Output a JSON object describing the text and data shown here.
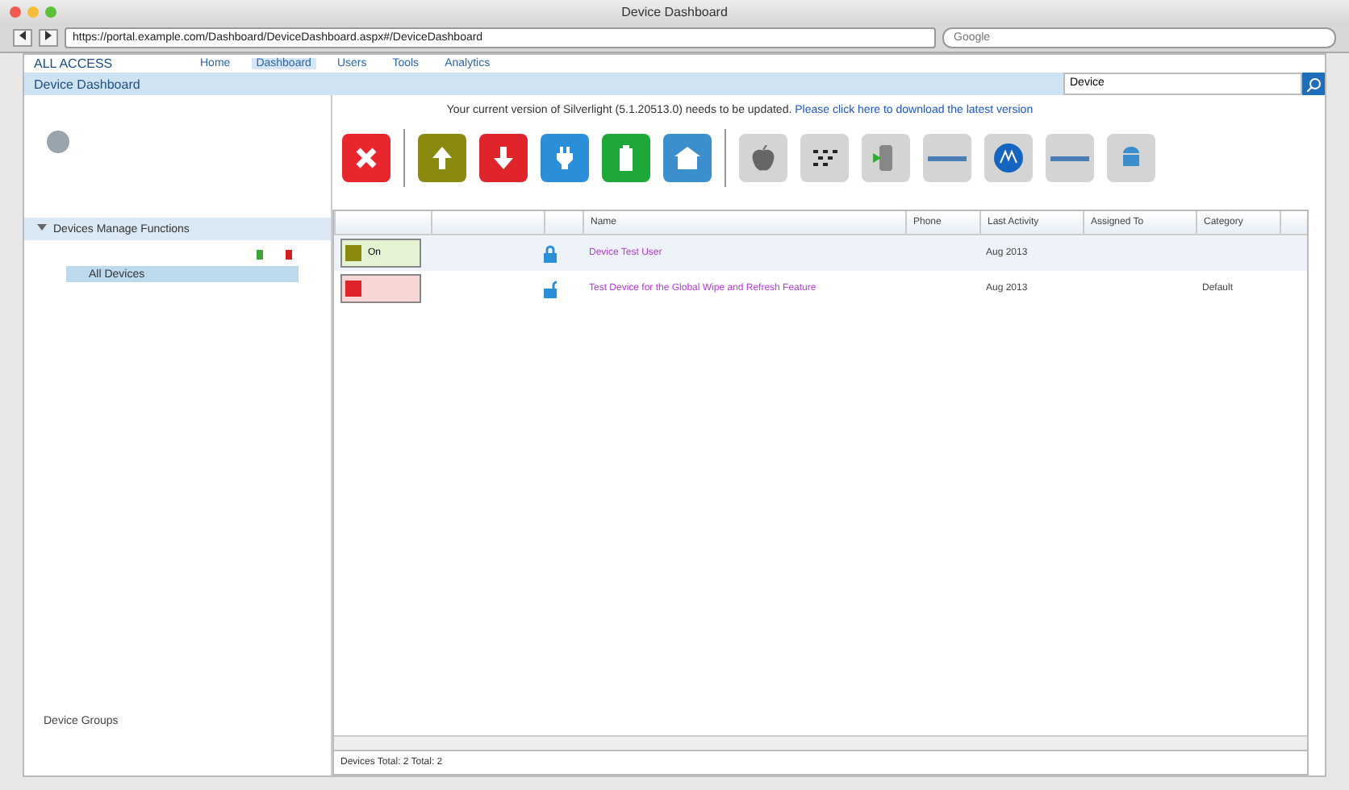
{
  "window": {
    "title": "Device Dashboard"
  },
  "browser": {
    "url": "https://portal.example.com/Dashboard/DeviceDashboard.aspx#/DeviceDashboard",
    "search_placeholder": "Google"
  },
  "app": {
    "brand": "ALL ACCESS",
    "nav": [
      {
        "label": "Home",
        "selected": false
      },
      {
        "label": "Dashboard",
        "selected": true
      },
      {
        "label": "Users",
        "selected": false
      },
      {
        "label": "Tools",
        "selected": false
      },
      {
        "label": "Analytics",
        "selected": false
      }
    ]
  },
  "header": {
    "title": "Device Dashboard",
    "search_value": "Device"
  },
  "notice": {
    "text": "Your current version of Silverlight (5.1.20513.0) needs to be updated.",
    "link": "Please click here to download the latest version"
  },
  "actions": [
    {
      "kind": "delete",
      "color": "#e8262e"
    },
    {
      "kind": "up",
      "color": "#8b8a10"
    },
    {
      "kind": "down",
      "color": "#e0242c"
    },
    {
      "kind": "plug",
      "color": "#2a8fd8"
    },
    {
      "kind": "battery",
      "color": "#1fa83a"
    },
    {
      "kind": "home",
      "color": "#3a8fcc"
    }
  ],
  "platforms": [
    {
      "kind": "apple"
    },
    {
      "kind": "berry"
    },
    {
      "kind": "play"
    },
    {
      "kind": "bar"
    },
    {
      "kind": "circle"
    },
    {
      "kind": "bar"
    },
    {
      "kind": "robot"
    }
  ],
  "sidebar": {
    "section": "Devices Manage Functions",
    "expanded": true,
    "items": [
      {
        "label": "All Devices",
        "selected": true
      }
    ],
    "footer": "Device Groups"
  },
  "table": {
    "columns": [
      "Name",
      "Phone",
      "Last Activity",
      "Assigned To",
      "Category"
    ],
    "rows": [
      {
        "kind": "up",
        "status_label": "On",
        "locked": true,
        "name": "Device Test User",
        "last_activity": "Aug 2013",
        "selected": true
      },
      {
        "kind": "down",
        "locked": false,
        "name": "Test Device for the Global Wipe and Refresh Feature",
        "last_activity": "Aug 2013",
        "category": "Default",
        "selected": false
      }
    ]
  },
  "status_bar": "Devices Total: 2 Total: 2"
}
